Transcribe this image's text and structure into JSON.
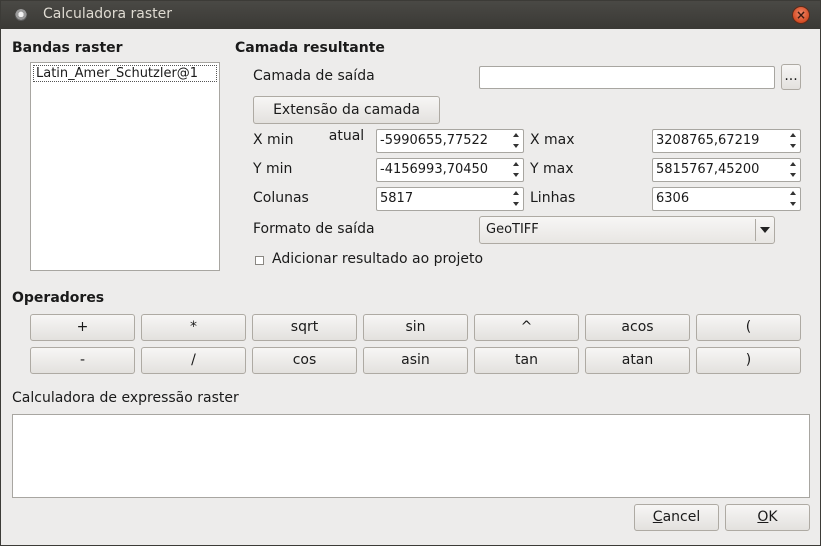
{
  "window": {
    "title": "Calculadora raster",
    "close_icon": "close-icon"
  },
  "bands": {
    "title": "Bandas raster",
    "items": [
      "Latin_Amer_Schutzler@1"
    ]
  },
  "result": {
    "title": "Camada resultante",
    "output_label": "Camada de saída",
    "output_value": "",
    "browse_label": "...",
    "extent_button": "Extensão da camada atual",
    "xmin_label": "X min",
    "xmin_value": "-5990655,77522",
    "xmax_label": "X max",
    "xmax_value": "3208765,67219",
    "ymin_label": "Y min",
    "ymin_value": "-4156993,70450",
    "ymax_label": "Y max",
    "ymax_value": "5815767,45200",
    "cols_label": "Colunas",
    "cols_value": "5817",
    "rows_label": "Linhas",
    "rows_value": "6306",
    "format_label": "Formato de saída",
    "format_value": "GeoTIFF",
    "add_checkbox_label": "Adicionar resultado ao projeto",
    "add_checked": false
  },
  "operators": {
    "title": "Operadores",
    "row1": [
      "+",
      "*",
      "sqrt",
      "sin",
      "^",
      "acos",
      "("
    ],
    "row2": [
      "-",
      "/",
      "cos",
      "asin",
      "tan",
      "atan",
      ")"
    ]
  },
  "expression": {
    "title": "Calculadora de expressão raster",
    "value": ""
  },
  "footer": {
    "cancel_prefix": "C",
    "cancel_rest": "ancel",
    "ok_prefix": "O",
    "ok_rest": "K"
  }
}
